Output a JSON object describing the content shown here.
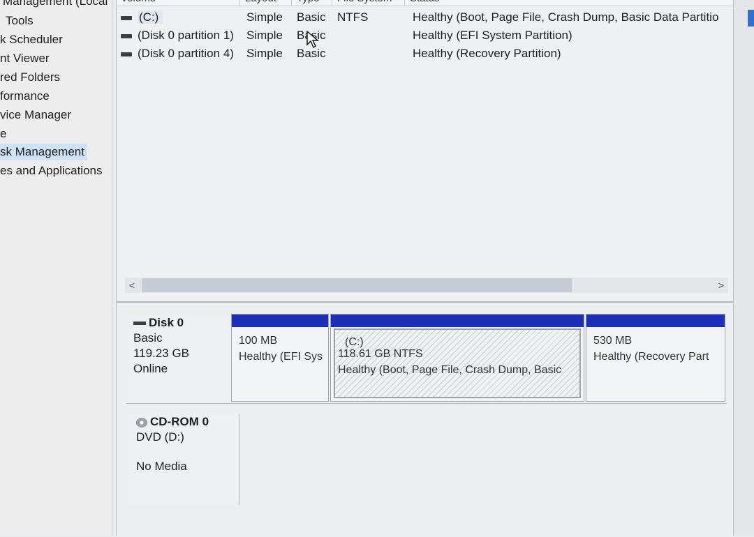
{
  "nav": {
    "items": [
      {
        "label": "Management (Local",
        "selected": false
      },
      {
        "label": "Tools",
        "selected": false
      },
      {
        "label": "k Scheduler",
        "selected": false
      },
      {
        "label": "nt Viewer",
        "selected": false
      },
      {
        "label": "red Folders",
        "selected": false
      },
      {
        "label": "formance",
        "selected": false
      },
      {
        "label": "vice Manager",
        "selected": false
      },
      {
        "label": "e",
        "selected": false
      },
      {
        "label": "sk Management",
        "selected": true
      },
      {
        "label": "es and Applications",
        "selected": false
      }
    ]
  },
  "volume_list": {
    "headers": [
      "Volume",
      "Layout",
      "Type",
      "File System",
      "Status"
    ],
    "rows": [
      {
        "volume": "(C:)",
        "layout": "Simple",
        "type": "Basic",
        "file_system": "NTFS",
        "status": "Healthy (Boot, Page File, Crash Dump, Basic Data Partitio"
      },
      {
        "volume": "(Disk 0 partition 1)",
        "layout": "Simple",
        "type": "Basic",
        "file_system": "",
        "status": "Healthy (EFI System Partition)"
      },
      {
        "volume": "(Disk 0 partition 4)",
        "layout": "Simple",
        "type": "Basic",
        "file_system": "",
        "status": "Healthy (Recovery Partition)"
      }
    ],
    "scroll_left_arrow": "<",
    "scroll_right_arrow": ">"
  },
  "disks": [
    {
      "title": "Disk 0",
      "kind": "Basic",
      "size": "119.23 GB",
      "state": "Online",
      "partitions": [
        {
          "name": "",
          "size": "100 MB",
          "status": "Healthy (EFI Sys"
        },
        {
          "name": "(C:)",
          "size": "118.61 GB NTFS",
          "status": "Healthy (Boot, Page File, Crash Dump, Basic"
        },
        {
          "name": "",
          "size": "530 MB",
          "status": "Healthy (Recovery Part"
        }
      ]
    },
    {
      "title": "CD-ROM 0",
      "kind": "DVD (D:)",
      "media": "No Media"
    }
  ],
  "colors": {
    "partition_bar": "#1b2fb7",
    "selection": "#cde3f5"
  }
}
